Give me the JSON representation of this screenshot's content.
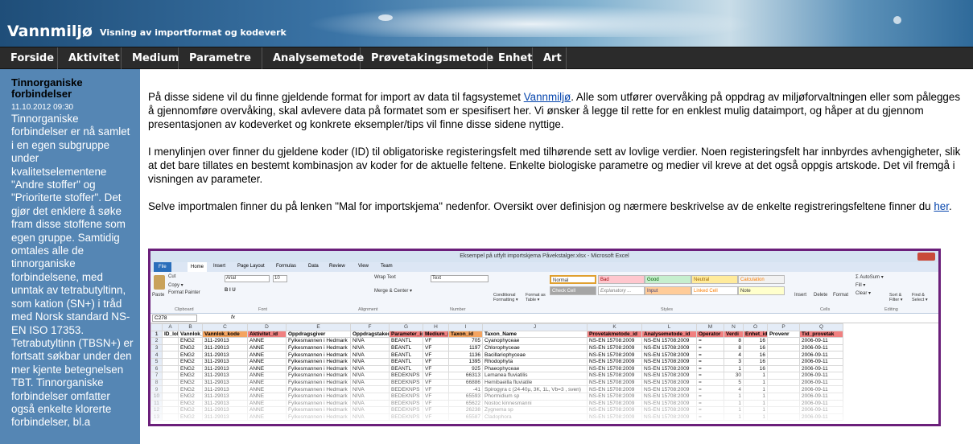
{
  "header": {
    "title": "Vannmiljø",
    "subtitle": "Visning av importformat og kodeverk"
  },
  "nav": {
    "items": [
      "Forside",
      "Aktivitet",
      "Medium",
      "Parametre ▼",
      "Analysemetode",
      "Prøvetakingsmetode",
      "Enhet",
      "Art"
    ]
  },
  "sidebar": {
    "news_title": "Tinnorganiske forbindelser",
    "news_date": "11.10.2012 09:30",
    "news_body": "Tinnorganiske forbindelser er nå samlet i en egen subgruppe under kvalitetselementene \"Andre stoffer\" og \"Prioriterte stoffer\". Det gjør det enklere å søke fram disse stoffene som egen gruppe. Samtidig omtales alle de tinnorganiske forbindelsene, med unntak av tetrabutyltinn, som kation (SN+) i tråd med Norsk standard NS-EN ISO 17353. Tetrabutyltinn (TBSN+) er fortsatt søkbar under den mer kjente betegnelsen TBT. Tinnorganiske forbindelser omfatter også enkelte klorerte forbindelser, bl.a"
  },
  "content": {
    "p1_before": "På disse sidene vil du finne gjeldende format for import av data til fagsystemet ",
    "p1_link": "Vannmiljø",
    "p1_after": ". Alle som utfører overvåking på oppdrag av miljøforvaltningen eller som pålegges å gjennomføre overvåking, skal avlevere data på formatet som er spesifisert her. Vi ønsker å legge til rette for en enklest mulig dataimport, og håper at du gjennom presentasjonen av kodeverket og konkrete eksempler/tips vil finne disse sidene nyttige.",
    "p2": "I menylinjen over finner du gjeldene koder (ID) til obligatoriske registeringsfelt med tilhørende sett av lovlige verdier. Noen registeringsfelt har innbyrdes avhengigheter, slik at det bare tillates en bestemt kombinasjon av koder for de aktuelle feltene. Enkelte biologiske parametre og medier vil kreve at det også oppgis artskode. Det vil fremgå i visningen av parameter.",
    "p3_before": "Selve importmalen finner du på lenken \"Mal for importskjema\" nedenfor. Oversikt over definisjon og nærmere beskrivelse av de enkelte registreringsfeltene finner du ",
    "p3_link": "her",
    "p3_after": "."
  },
  "excel": {
    "window_title": "Eksempel på utfylt importskjema Påvekstalger.xlsx - Microsoft Excel",
    "tabs": [
      "File",
      "Home",
      "Insert",
      "Page Layout",
      "Formulas",
      "Data",
      "Review",
      "View",
      "Team"
    ],
    "ribbon": {
      "cut": "Cut",
      "copy": "Copy ▾",
      "format_painter": "Format Painter",
      "paste": "Paste",
      "font": "Arial",
      "font_size": "10",
      "wrap": "Wrap Text",
      "merge": "Merge & Center ▾",
      "number_format": "Text",
      "cond_format": "Conditional Formatting ▾",
      "format_table": "Format as Table ▾",
      "styles": [
        "Normal",
        "Bad",
        "Good",
        "Neutral",
        "Calculation",
        "Check Cell",
        "Explanatory ...",
        "Input",
        "Linked Cell",
        "Note"
      ],
      "insert": "Insert",
      "delete": "Delete",
      "format": "Format",
      "autosum": "Σ AutoSum ▾",
      "fill": "Fill ▾",
      "clear": "Clear ▾",
      "sort": "Sort & Filter ▾",
      "find": "Find & Select ▾",
      "groups": [
        "Clipboard",
        "Font",
        "Alignment",
        "Number",
        "Styles",
        "Cells",
        "Editing"
      ]
    },
    "name_box": "C278",
    "fx": "fx",
    "col_letters": [
      "",
      "A",
      "B",
      "C",
      "D",
      "E",
      "F",
      "G",
      "H",
      "I",
      "J",
      "K",
      "L",
      "M",
      "N",
      "O",
      "P",
      "Q"
    ],
    "headers": [
      "1",
      "ID_lokal",
      "Vannlok_Na",
      "Vannlok_kode",
      "Aktivitet_id",
      "Oppdragsgiver",
      "Oppdragstaker",
      "Parameter_id",
      "Medium_id",
      "Taxon_id",
      "Taxon_Name",
      "Provetakmetode_id",
      "Analysemetode_id",
      "Operator",
      "Verdi",
      "Enhet_id",
      "Provenr",
      "Tid_provetak"
    ],
    "rows": [
      [
        "2",
        "",
        "ENG2",
        "311-29013",
        "ANNE",
        "Fylkesmannen i Hedmark",
        "NIVA",
        "BEANTL",
        "VF",
        "705",
        "Cyanophyceae",
        "NS-EN 15708:2009",
        "NS-EN 15708:2009",
        "=",
        "8",
        "16",
        "",
        "2006-09-11"
      ],
      [
        "3",
        "",
        "ENG2",
        "311-29013",
        "ANNE",
        "Fylkesmannen i Hedmark",
        "NIVA",
        "BEANTL",
        "VF",
        "1197",
        "Chlorophyceae",
        "NS-EN 15708:2009",
        "NS-EN 15708:2009",
        "=",
        "8",
        "16",
        "",
        "2006-09-11"
      ],
      [
        "4",
        "",
        "ENG2",
        "311-29013",
        "ANNE",
        "Fylkesmannen i Hedmark",
        "NIVA",
        "BEANTL",
        "VF",
        "1136",
        "Bacillariophyceae",
        "NS-EN 15708:2009",
        "NS-EN 15708:2009",
        "=",
        "4",
        "16",
        "",
        "2006-09-11"
      ],
      [
        "5",
        "",
        "ENG2",
        "311-29013",
        "ANNE",
        "Fylkesmannen i Hedmark",
        "NIVA",
        "BEANTL",
        "VF",
        "1395",
        "Rhodophyta",
        "NS-EN 15708:2009",
        "NS-EN 15708:2009",
        "=",
        "3",
        "16",
        "",
        "2006-09-11"
      ],
      [
        "6",
        "",
        "ENG2",
        "311-29013",
        "ANNE",
        "Fylkesmannen i Hedmark",
        "NIVA",
        "BEANTL",
        "VF",
        "925",
        "Phaeophyceae",
        "NS-EN 15708:2009",
        "NS-EN 15708:2009",
        "=",
        "1",
        "16",
        "",
        "2006-09-11"
      ],
      [
        "7",
        "",
        "ENG2",
        "311-29013",
        "ANNE",
        "Fylkesmannen i Hedmark",
        "NIVA",
        "BEDEKNPS",
        "VF",
        "66313",
        "Lemanea fluviatilis",
        "NS-EN 15708:2009",
        "NS-EN 15708:2009",
        "=",
        "30",
        "1",
        "",
        "2006-09-11"
      ],
      [
        "8",
        "",
        "ENG2",
        "311-29013",
        "ANNE",
        "Fylkesmannen i Hedmark",
        "NIVA",
        "BEDEKNPS",
        "VF",
        "66886",
        "Hemibaeilla fluviatile",
        "NS-EN 15708:2009",
        "NS-EN 15708:2009",
        "=",
        "5",
        "1",
        "",
        "2006-09-11"
      ],
      [
        "9",
        "",
        "ENG2",
        "311-29013",
        "ANNE",
        "Fylkesmannen i Hedmark",
        "NIVA",
        "BEDEKNPS",
        "VF",
        "-41",
        "Spirogyra c (24-40µ, 3K, 1L, Vb=3 , sven)",
        "NS-EN 15708:2009",
        "NS-EN 15708:2009",
        "=",
        "4",
        "1",
        "",
        "2006-09-11"
      ],
      [
        "10",
        "",
        "ENG2",
        "311-29013",
        "ANNE",
        "Fylkesmannen i Hedmark",
        "NIVA",
        "BEDEKNPS",
        "VF",
        "65593",
        "Phormidium sp",
        "NS-EN 15708:2009",
        "NS-EN 15708:2009",
        "=",
        "1",
        "1",
        "",
        "2006-09-11"
      ],
      [
        "11",
        "",
        "ENG2",
        "311-29013",
        "ANNE",
        "Fylkesmannen i Hedmark",
        "NIVA",
        "BEDEKNPS",
        "VF",
        "65622",
        "Nostoc kinnesmanni",
        "NS-EN 15708:2009",
        "NS-EN 15708:2009",
        "=",
        "1",
        "1",
        "",
        "2006-09-11"
      ],
      [
        "12",
        "",
        "ENG2",
        "311-29013",
        "ANNE",
        "Fylkesmannen i Hedmark",
        "NIVA",
        "BEDEKNPS",
        "VF",
        "26238",
        "Zygnema sp",
        "NS-EN 15708:2009",
        "NS-EN 15708:2009",
        "=",
        "1",
        "1",
        "",
        "2006-09-11"
      ],
      [
        "13",
        "",
        "ENG2",
        "311-29013",
        "ANNE",
        "Fylkesmannen i Hedmark",
        "NIVA",
        "BEDEKNPS",
        "VF",
        "65587",
        "Cladophora",
        "NS-EN 15708:2009",
        "NS-EN 15708:2009",
        "=",
        "1",
        "1",
        "",
        "2006-09-11"
      ]
    ],
    "header_colors": [
      "#ffffff",
      "#ffffff",
      "#ffffff",
      "#f4a460",
      "#f08080",
      "#ffffff",
      "#ffffff",
      "#f08080",
      "#f08080",
      "#f4a460",
      "#ffffff",
      "#f08080",
      "#f08080",
      "#f08080",
      "#f08080",
      "#f08080",
      "#ffffff",
      "#f08080"
    ]
  },
  "colors": {
    "accent": "#6b1f7a",
    "sidebar": "#5586b4",
    "nav": "#2b2b2b",
    "link": "#0645ad"
  }
}
